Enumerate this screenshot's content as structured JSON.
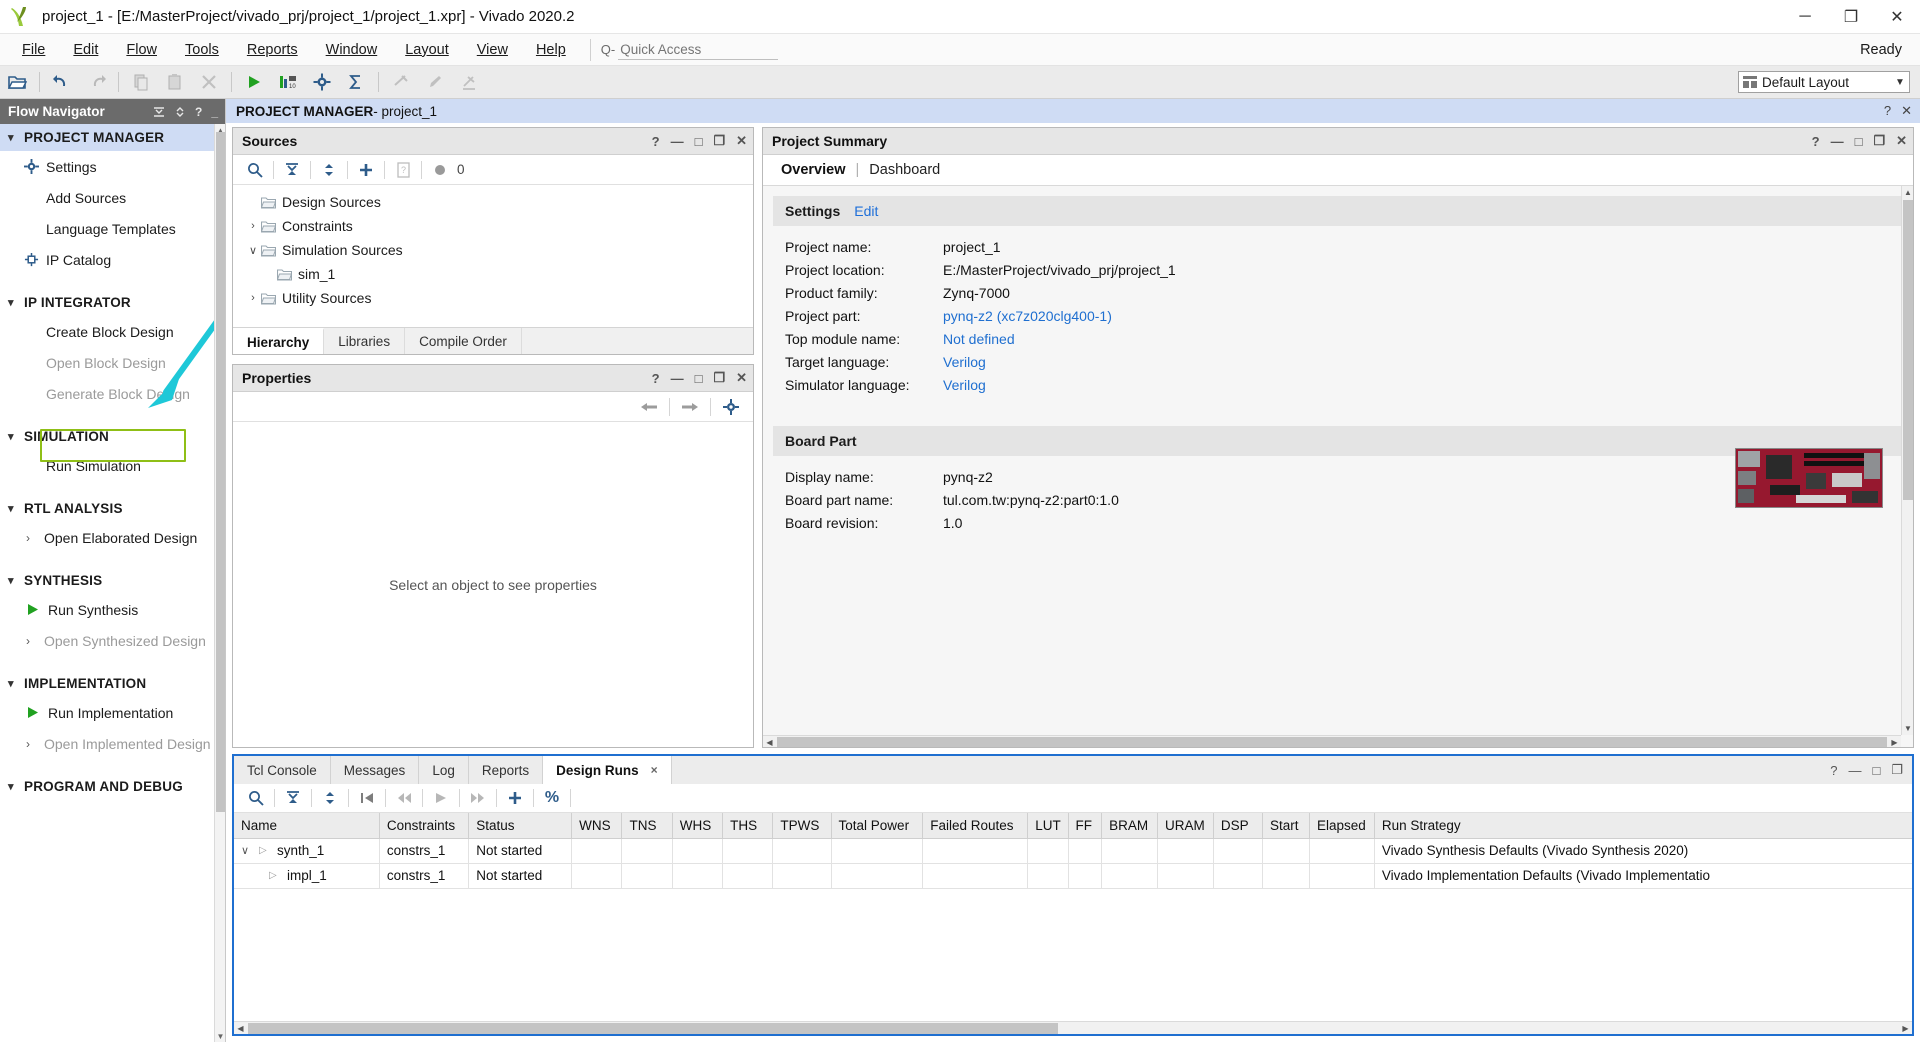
{
  "titlebar": {
    "title": "project_1 - [E:/MasterProject/vivado_prj/project_1/project_1.xpr] - Vivado 2020.2",
    "minimize": "─",
    "maximize": "❐",
    "close": "✕"
  },
  "menubar": {
    "items": [
      "File",
      "Edit",
      "Flow",
      "Tools",
      "Reports",
      "Window",
      "Layout",
      "View",
      "Help"
    ],
    "quick_access_placeholder": "Quick Access",
    "quick_access_value": "",
    "status": "Ready"
  },
  "toolbar": {
    "layout_selected": "Default Layout"
  },
  "flow_navigator": {
    "title": "Flow Navigator",
    "sections": [
      {
        "label": "PROJECT MANAGER",
        "active": true,
        "items": [
          {
            "label": "Settings",
            "icon": "gear-icon",
            "disabled": false
          },
          {
            "label": "Add Sources",
            "icon": "none",
            "disabled": false
          },
          {
            "label": "Language Templates",
            "icon": "none",
            "disabled": false
          },
          {
            "label": "IP Catalog",
            "icon": "ip-icon",
            "disabled": false
          }
        ]
      },
      {
        "label": "IP INTEGRATOR",
        "active": false,
        "items": [
          {
            "label": "Create Block Design",
            "icon": "none",
            "disabled": false,
            "highlighted": true
          },
          {
            "label": "Open Block Design",
            "icon": "none",
            "disabled": true
          },
          {
            "label": "Generate Block Design",
            "icon": "none",
            "disabled": true
          }
        ]
      },
      {
        "label": "SIMULATION",
        "active": false,
        "items": [
          {
            "label": "Run Simulation",
            "icon": "none",
            "disabled": false
          }
        ]
      },
      {
        "label": "RTL ANALYSIS",
        "active": false,
        "items": [
          {
            "label": "Open Elaborated Design",
            "icon": "chevron",
            "disabled": false
          }
        ]
      },
      {
        "label": "SYNTHESIS",
        "active": false,
        "items": [
          {
            "label": "Run Synthesis",
            "icon": "play-icon",
            "disabled": false
          },
          {
            "label": "Open Synthesized Design",
            "icon": "chevron",
            "disabled": true
          }
        ]
      },
      {
        "label": "IMPLEMENTATION",
        "active": false,
        "items": [
          {
            "label": "Run Implementation",
            "icon": "play-icon",
            "disabled": false
          },
          {
            "label": "Open Implemented Design",
            "icon": "chevron",
            "disabled": true
          }
        ]
      },
      {
        "label": "PROGRAM AND DEBUG",
        "active": false,
        "items": []
      }
    ]
  },
  "project_manager_bar": {
    "prefix": "PROJECT MANAGER",
    "suffix": " - project_1"
  },
  "sources": {
    "title": "Sources",
    "toolbar_count": "0",
    "tree": [
      {
        "label": "Design Sources",
        "twisty": "",
        "depth": 1
      },
      {
        "label": "Constraints",
        "twisty": "›",
        "depth": 1
      },
      {
        "label": "Simulation Sources",
        "twisty": "∨",
        "depth": 1
      },
      {
        "label": "sim_1",
        "twisty": "",
        "depth": 2
      },
      {
        "label": "Utility Sources",
        "twisty": "›",
        "depth": 1
      }
    ],
    "tabs": [
      {
        "label": "Hierarchy",
        "active": true
      },
      {
        "label": "Libraries",
        "active": false
      },
      {
        "label": "Compile Order",
        "active": false
      }
    ]
  },
  "properties": {
    "title": "Properties",
    "empty_message": "Select an object to see properties"
  },
  "project_summary": {
    "title": "Project Summary",
    "tabs": {
      "overview": "Overview",
      "divider": "|",
      "dashboard": "Dashboard"
    },
    "settings_card": {
      "heading": "Settings",
      "edit_link": "Edit",
      "rows": [
        {
          "key": "Project name:",
          "value": "project_1",
          "link": false
        },
        {
          "key": "Project location:",
          "value": "E:/MasterProject/vivado_prj/project_1",
          "link": false
        },
        {
          "key": "Product family:",
          "value": "Zynq-7000",
          "link": false
        },
        {
          "key": "Project part:",
          "value": "pynq-z2 (xc7z020clg400-1)",
          "link": true
        },
        {
          "key": "Top module name:",
          "value": "Not defined",
          "link": true
        },
        {
          "key": "Target language:",
          "value": "Verilog",
          "link": true
        },
        {
          "key": "Simulator language:",
          "value": "Verilog",
          "link": true
        }
      ]
    },
    "board_card": {
      "heading": "Board Part",
      "rows": [
        {
          "key": "Display name:",
          "value": "pynq-z2"
        },
        {
          "key": "Board part name:",
          "value": "tul.com.tw:pynq-z2:part0:1.0"
        },
        {
          "key": "Board revision:",
          "value": "1.0"
        }
      ]
    }
  },
  "bottom_dock": {
    "tabs": [
      {
        "label": "Tcl Console",
        "active": false,
        "closable": false
      },
      {
        "label": "Messages",
        "active": false,
        "closable": false
      },
      {
        "label": "Log",
        "active": false,
        "closable": false
      },
      {
        "label": "Reports",
        "active": false,
        "closable": false
      },
      {
        "label": "Design Runs",
        "active": true,
        "closable": true
      }
    ],
    "close_glyph": "×",
    "toolbar": {
      "percent_label": "%"
    },
    "table": {
      "columns": [
        "Name",
        "Constraints",
        "Status",
        "WNS",
        "TNS",
        "WHS",
        "THS",
        "TPWS",
        "Total Power",
        "Failed Routes",
        "LUT",
        "FF",
        "BRAM",
        "URAM",
        "DSP",
        "Start",
        "Elapsed",
        "Run Strategy"
      ],
      "rows": [
        {
          "indent": 0,
          "twisty": "∨",
          "triangle": "▷",
          "cells": [
            "synth_1",
            "constrs_1",
            "Not started",
            "",
            "",
            "",
            "",
            "",
            "",
            "",
            "",
            "",
            "",
            "",
            "",
            "",
            "",
            "Vivado Synthesis Defaults (Vivado Synthesis 2020)"
          ]
        },
        {
          "indent": 1,
          "twisty": "",
          "triangle": "▷",
          "cells": [
            "impl_1",
            "constrs_1",
            "Not started",
            "",
            "",
            "",
            "",
            "",
            "",
            "",
            "",
            "",
            "",
            "",
            "",
            "",
            "",
            "Vivado Implementation Defaults (Vivado Implementatio"
          ]
        }
      ]
    }
  },
  "panel_buttons": {
    "help": "?",
    "minimize": "—",
    "maximize": "□",
    "float": "❐",
    "close": "✕"
  },
  "colors": {
    "accent_blue": "#1f6fd0",
    "highlight_green": "#8fbf16",
    "arrow_cyan": "#1ec8d8",
    "selection_blue": "#cfdcf4",
    "navigator_header": "#6b6b6b"
  }
}
